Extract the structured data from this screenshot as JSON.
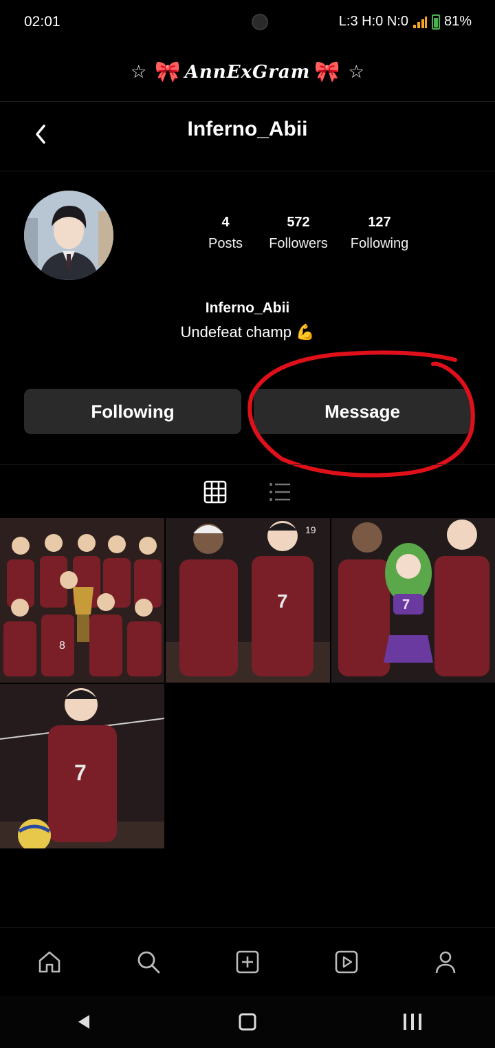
{
  "status_bar": {
    "time": "02:01",
    "network": "L:3 H:0 N:0",
    "battery": "81%"
  },
  "app": {
    "title": "AnnExGram",
    "left_deco": "☆",
    "right_deco": "☆",
    "bow_glyph": "🎀"
  },
  "profile": {
    "header_username": "Inferno_Abii",
    "display_name": "Inferno_Abii",
    "bio": "Undefeat champ 💪",
    "stats": {
      "posts_count": "4",
      "posts_label": "Posts",
      "followers_count": "572",
      "followers_label": "Followers",
      "following_count": "127",
      "following_label": "Following"
    }
  },
  "actions": {
    "following_label": "Following",
    "message_label": "Message"
  },
  "annotation": {
    "highlight_color": "#e0101a"
  },
  "posts": [
    {
      "jersey": "8"
    },
    {
      "jersey": "7"
    },
    {
      "jersey": "7"
    },
    {
      "jersey": "7"
    }
  ],
  "bottom_nav": [
    "home-icon",
    "search-icon",
    "add-post-icon",
    "reels-icon",
    "profile-icon"
  ],
  "colors": {
    "background": "#000000",
    "button_bg": "#2a2a2a",
    "jersey_red": "#7a1f27"
  }
}
